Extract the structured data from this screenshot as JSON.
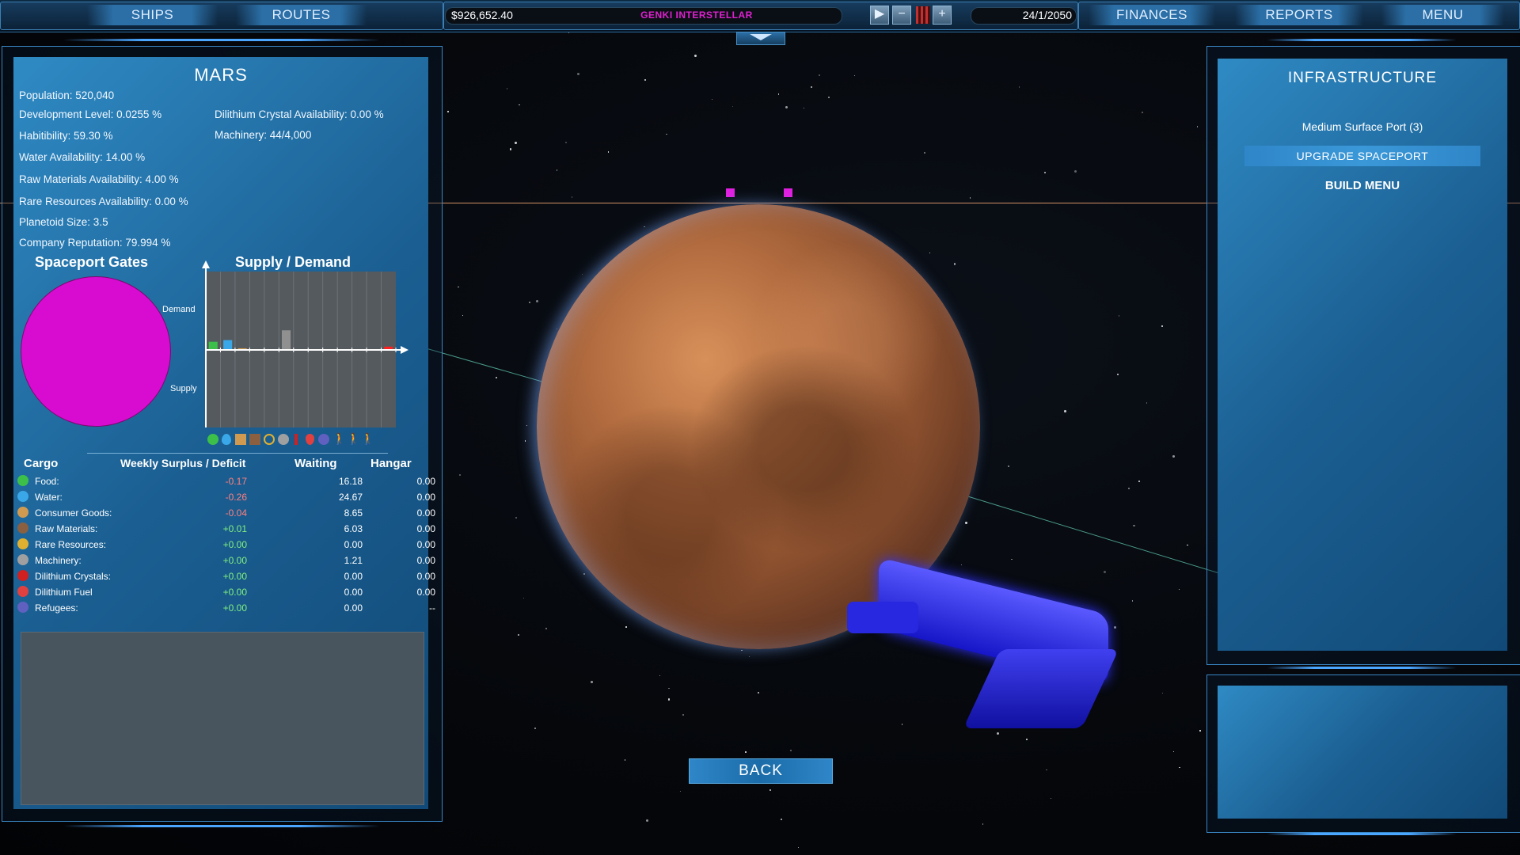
{
  "topbar": {
    "ships": "SHIPS",
    "routes": "ROUTES",
    "money": "$926,652.40",
    "company": "GENKI INTERSTELLAR",
    "date": "24/1/2050",
    "finances": "FINANCES",
    "reports": "REPORTS",
    "menu": "MENU",
    "company_color": "#e020d0"
  },
  "planet": {
    "name": "MARS",
    "stats": [
      "Population: 520,040",
      "Development Level: 0.0255 %",
      "Habitibility: 59.30 %",
      "Water Availability: 14.00 %",
      "Raw Materials Availability: 4.00 %",
      "Rare Resources Availability: 0.00 %",
      "Planetoid Size: 3.5",
      "Company Reputation: 79.994 %"
    ],
    "stats_right": [
      "Dilithium Crystal Availability: 0.00 %",
      "Machinery: 44/4,000"
    ]
  },
  "spaceport_gates": {
    "title": "Spaceport Gates",
    "color": "#d80cd0"
  },
  "supply_demand": {
    "title": "Supply / Demand",
    "demand_label": "Demand",
    "supply_label": "Supply"
  },
  "cargo": {
    "headers": [
      "Cargo",
      "Weekly Surplus / Deficit",
      "Waiting",
      "Hangar"
    ],
    "rows": [
      {
        "icon": "food-icon",
        "name": "Food:",
        "surplus": "-0.17",
        "waiting": "16.18",
        "hangar": "0.00"
      },
      {
        "icon": "water-icon",
        "name": "Water:",
        "surplus": "-0.26",
        "waiting": "24.67",
        "hangar": "0.00"
      },
      {
        "icon": "consumer-goods-icon",
        "name": "Consumer Goods:",
        "surplus": "-0.04",
        "waiting": "8.65",
        "hangar": "0.00"
      },
      {
        "icon": "raw-materials-icon",
        "name": "Raw Materials:",
        "surplus": "+0.01",
        "waiting": "6.03",
        "hangar": "0.00"
      },
      {
        "icon": "rare-resources-icon",
        "name": "Rare Resources:",
        "surplus": "+0.00",
        "waiting": "0.00",
        "hangar": "0.00"
      },
      {
        "icon": "machinery-icon",
        "name": "Machinery:",
        "surplus": "+0.00",
        "waiting": "1.21",
        "hangar": "0.00"
      },
      {
        "icon": "dilithium-crystals-icon",
        "name": "Dilithium Crystals:",
        "surplus": "+0.00",
        "waiting": "0.00",
        "hangar": "0.00"
      },
      {
        "icon": "dilithium-fuel-icon",
        "name": "Dilithium Fuel",
        "surplus": "+0.00",
        "waiting": "0.00",
        "hangar": "0.00"
      },
      {
        "icon": "refugees-icon",
        "name": "Refugees:",
        "surplus": "+0.00",
        "waiting": "0.00",
        "hangar": "--"
      }
    ]
  },
  "infrastructure": {
    "title": "INFRASTRUCTURE",
    "port": "Medium Surface Port (3)",
    "upgrade": "UPGRADE SPACEPORT",
    "build": "BUILD MENU"
  },
  "back": "BACK",
  "chart_data": {
    "type": "bar",
    "title": "Supply / Demand",
    "categories": [
      "Food",
      "Water",
      "Consumer Goods",
      "Raw Materials",
      "Rare Resources",
      "Machinery",
      "Dilithium Crystals",
      "Dilithium Fuel",
      "Refugees",
      "Passengers A",
      "Passengers B",
      "Passengers C",
      "Passengers D"
    ],
    "values": [
      0.5,
      0.6,
      0.1,
      0.05,
      0,
      1.2,
      0,
      0,
      0,
      0,
      0,
      0,
      0.2
    ],
    "colors": [
      "#3cc04a",
      "#3aa8e8",
      "#d09a50",
      "#a07040",
      "#e0b030",
      "#909090",
      "#d02020",
      "#e04040",
      "#6060c0",
      "#555",
      "#555",
      "#555",
      "#ff2020"
    ],
    "xlabel": "",
    "ylabel": "",
    "grid": true
  }
}
